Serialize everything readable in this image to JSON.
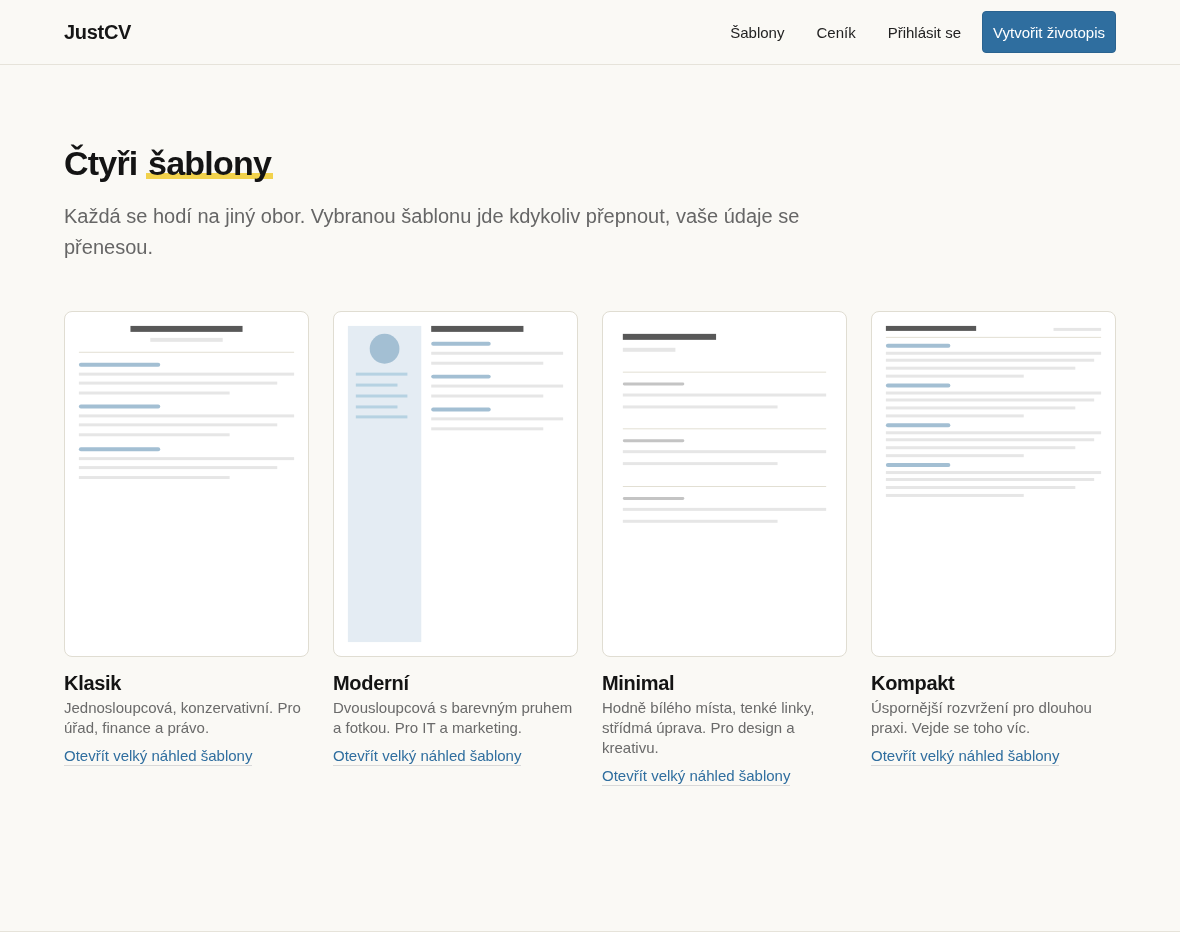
{
  "header": {
    "logo": "JustCV",
    "nav": [
      "Šablony",
      "Ceník",
      "Přihlásit se"
    ],
    "cta": "Vytvořit životopis"
  },
  "hero": {
    "heading": {
      "text": "Čtyři",
      "highlighted": "šablony"
    },
    "subtitle": "Každá se hodí na jiný obor. Vybranou šablonu jde kdykoliv přepnout, vaše údaje se přenesou."
  },
  "templates": [
    {
      "kind": "classic",
      "name": "Klasik",
      "description": "Jednosloupcová, konzervativní. Pro úřad, finance a právo.",
      "link": "Otevřít velký náhled šablony"
    },
    {
      "kind": "modern",
      "name": "Moderní",
      "description": "Dvousloupcová s barevným pruhem a fotkou. Pro IT a marketing.",
      "link": "Otevřít velký náhled šablony"
    },
    {
      "kind": "minimal",
      "name": "Minimal",
      "description": "Hodně bílého místa, tenké linky, střídmá úprava. Pro design a kreativu.",
      "link": "Otevřít velký náhled šablony"
    },
    {
      "kind": "compact",
      "name": "Kompakt",
      "description": "Úspornější rozvržení pro dlouhou praxi. Vejde se toho víc.",
      "link": "Otevřít velký náhled šablony"
    }
  ]
}
